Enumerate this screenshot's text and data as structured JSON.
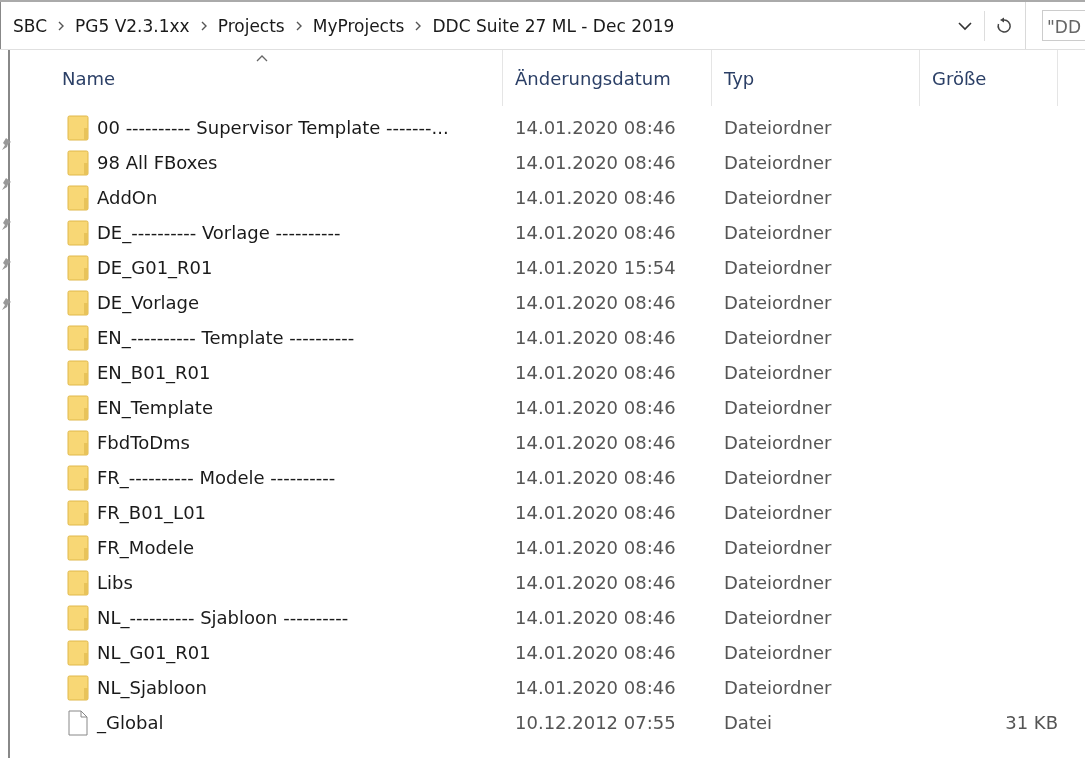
{
  "breadcrumb": [
    "SBC",
    "PG5 V2.3.1xx",
    "Projects",
    "MyProjects",
    "DDC Suite 27 ML - Dec 2019"
  ],
  "search": {
    "value": "\"DD"
  },
  "columns": [
    {
      "label": "Name",
      "sorted": true
    },
    {
      "label": "Änderungsdatum",
      "sorted": false
    },
    {
      "label": "Typ",
      "sorted": false
    },
    {
      "label": "Größe",
      "sorted": false
    }
  ],
  "rows": [
    {
      "kind": "folder",
      "name": "00 ---------- Supervisor Template -------...",
      "date": "14.01.2020 08:46",
      "type": "Dateiordner"
    },
    {
      "kind": "folder",
      "name": "98 All FBoxes",
      "date": "14.01.2020 08:46",
      "type": "Dateiordner"
    },
    {
      "kind": "folder",
      "name": "AddOn",
      "date": "14.01.2020 08:46",
      "type": "Dateiordner"
    },
    {
      "kind": "folder",
      "name": "DE_---------- Vorlage ----------",
      "date": "14.01.2020 08:46",
      "type": "Dateiordner"
    },
    {
      "kind": "folder",
      "name": "DE_G01_R01",
      "date": "14.01.2020 15:54",
      "type": "Dateiordner"
    },
    {
      "kind": "folder",
      "name": "DE_Vorlage",
      "date": "14.01.2020 08:46",
      "type": "Dateiordner"
    },
    {
      "kind": "folder",
      "name": "EN_---------- Template ----------",
      "date": "14.01.2020 08:46",
      "type": "Dateiordner"
    },
    {
      "kind": "folder",
      "name": "EN_B01_R01",
      "date": "14.01.2020 08:46",
      "type": "Dateiordner"
    },
    {
      "kind": "folder",
      "name": "EN_Template",
      "date": "14.01.2020 08:46",
      "type": "Dateiordner"
    },
    {
      "kind": "folder",
      "name": "FbdToDms",
      "date": "14.01.2020 08:46",
      "type": "Dateiordner"
    },
    {
      "kind": "folder",
      "name": "FR_---------- Modele ----------",
      "date": "14.01.2020 08:46",
      "type": "Dateiordner"
    },
    {
      "kind": "folder",
      "name": "FR_B01_L01",
      "date": "14.01.2020 08:46",
      "type": "Dateiordner"
    },
    {
      "kind": "folder",
      "name": "FR_Modele",
      "date": "14.01.2020 08:46",
      "type": "Dateiordner"
    },
    {
      "kind": "folder",
      "name": "Libs",
      "date": "14.01.2020 08:46",
      "type": "Dateiordner"
    },
    {
      "kind": "folder",
      "name": "NL_---------- Sjabloon ----------",
      "date": "14.01.2020 08:46",
      "type": "Dateiordner"
    },
    {
      "kind": "folder",
      "name": "NL_G01_R01",
      "date": "14.01.2020 08:46",
      "type": "Dateiordner"
    },
    {
      "kind": "folder",
      "name": "NL_Sjabloon",
      "date": "14.01.2020 08:46",
      "type": "Dateiordner"
    },
    {
      "kind": "file",
      "name": "_Global",
      "date": "10.12.2012 07:55",
      "type": "Datei",
      "size": "31 KB"
    }
  ]
}
